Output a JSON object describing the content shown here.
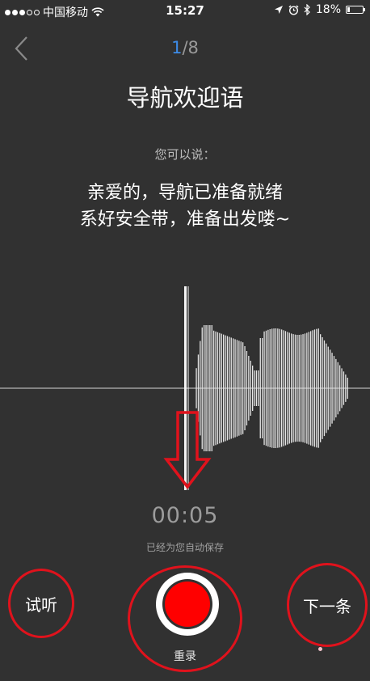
{
  "status_bar": {
    "carrier": "中国移动",
    "time": "15:27",
    "battery": "18%",
    "battery_level": 0.18,
    "signal_bars_on": 3,
    "signal_bars_total": 5
  },
  "nav": {
    "counter_current": "1",
    "counter_total": "/8",
    "title": "导航欢迎语"
  },
  "content": {
    "hint": "您可以说：",
    "prompt_line1": "亲爱的，导航已准备就绪",
    "prompt_line2": "系好安全带，准备出发喽~"
  },
  "recording": {
    "timer": "00:05",
    "saved_note": "已经为您自动保存"
  },
  "controls": {
    "listen_label": "试听",
    "next_label": "下一条",
    "rerecord_label": "重录"
  },
  "colors": {
    "background": "#313131",
    "accent_blue": "#3d8ce8",
    "record_red": "#ff0000",
    "annotation_red": "#e0121c"
  },
  "icons": {
    "back": "chevron-left-icon",
    "wifi": "wifi-icon",
    "location": "location-arrow-icon",
    "alarm": "alarm-clock-icon",
    "bluetooth": "bluetooth-icon",
    "battery": "battery-icon"
  }
}
